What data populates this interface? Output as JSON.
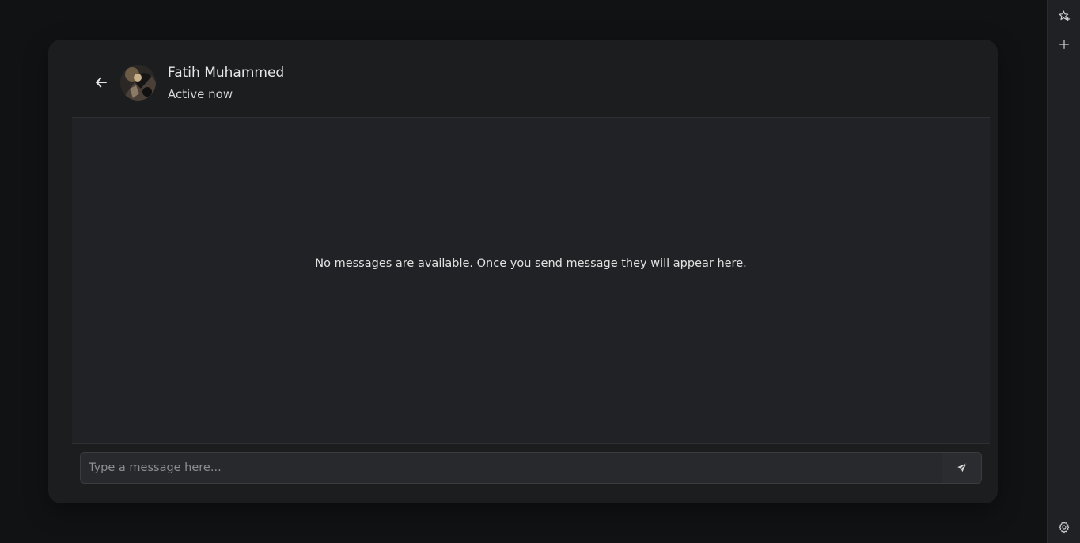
{
  "contact": {
    "name": "Fatih Muhammed",
    "status": "Active now"
  },
  "messages": {
    "empty_text": "No messages are available. Once you send message they will appear here."
  },
  "composer": {
    "placeholder": "Type a message here...",
    "value": ""
  },
  "icons": {
    "back": "arrow-left-icon",
    "send": "paper-plane-icon",
    "rail_top": "sparkle-star-icon",
    "rail_add": "plus-icon",
    "rail_settings": "gear-icon"
  },
  "colors": {
    "page_background": "#111213",
    "card_background": "#1c1d1f",
    "messages_background": "#212225",
    "input_background": "#27292c",
    "text_primary": "#e7e7e7",
    "placeholder": "#8c8e92"
  }
}
